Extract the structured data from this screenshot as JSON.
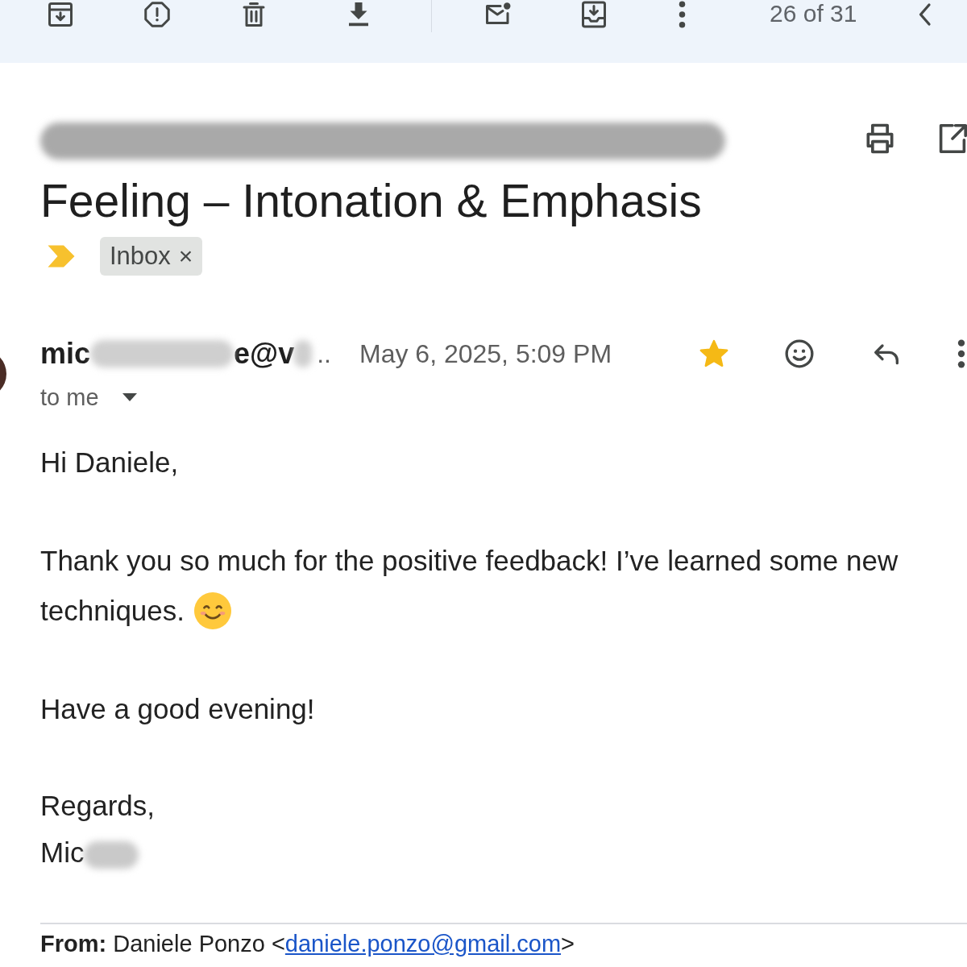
{
  "toolbar": {
    "counter": "26 of 31"
  },
  "subject": {
    "redacted_line": true,
    "title": "Feeling – Intonation & Emphasis",
    "important": true,
    "labels": [
      {
        "label": "Inbox",
        "remove": "×"
      }
    ]
  },
  "message": {
    "sender": {
      "visible_parts": [
        "mic",
        "e@v",
        ".."
      ],
      "redacted": true
    },
    "date": "May 6, 2025, 5:09 PM",
    "starred": true,
    "recipient": "to me",
    "body": [
      {
        "kind": "paragraph",
        "text": "Hi Daniele,"
      },
      {
        "kind": "paragraph_with_emoji",
        "lines": [
          "Thank you so much for the positive feedback! I’ve learned some new",
          "techniques."
        ]
      },
      {
        "kind": "paragraph",
        "text": "Have a good evening!"
      },
      {
        "kind": "closing",
        "text": "Regards,"
      },
      {
        "kind": "signature",
        "text": "Mic",
        "redacted": true
      }
    ]
  },
  "quoted": {
    "text_before": "**From:** Daniele Ponzo <",
    "email": "daniele.ponzo@gmail.com",
    "text_after": ">"
  }
}
